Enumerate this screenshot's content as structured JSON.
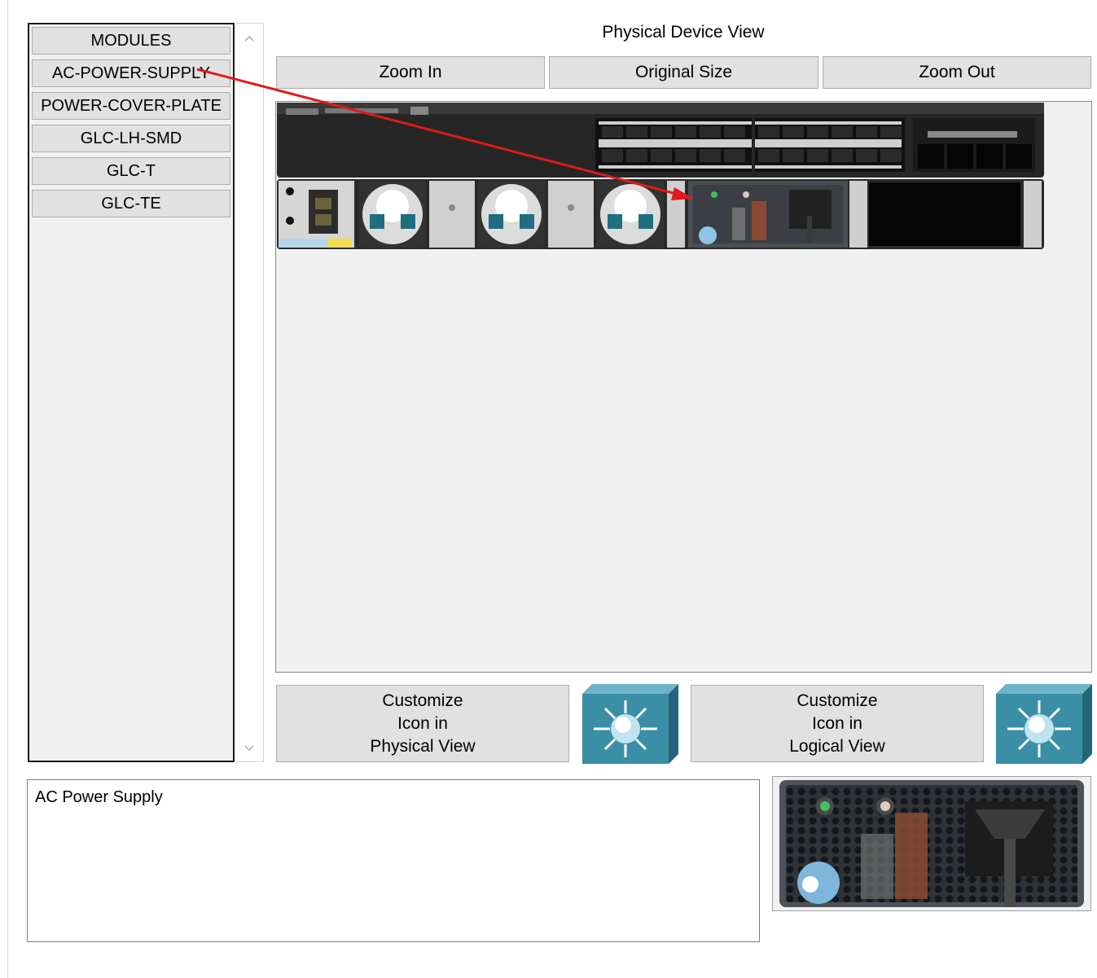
{
  "modules": {
    "items": [
      "MODULES",
      "AC-POWER-SUPPLY",
      "POWER-COVER-PLATE",
      "GLC-LH-SMD",
      "GLC-T",
      "GLC-TE"
    ]
  },
  "physical_view": {
    "title": "Physical Device View",
    "zoom_in": "Zoom In",
    "original_size": "Original Size",
    "zoom_out": "Zoom Out"
  },
  "customize": {
    "physical_line1": "Customize",
    "physical_line2": "Icon in",
    "physical_line3": "Physical View",
    "logical_line1": "Customize",
    "logical_line2": "Icon in",
    "logical_line3": "Logical View"
  },
  "description": {
    "text": "AC Power Supply"
  },
  "colors": {
    "annotation_arrow": "#e0191b",
    "switch_icon": "#3a8fa6",
    "device_body": "#2a2a2a"
  },
  "icons": {
    "scroll_up": "chevron-up-icon",
    "scroll_down": "chevron-down-icon",
    "switch": "multilayer-switch-icon"
  }
}
